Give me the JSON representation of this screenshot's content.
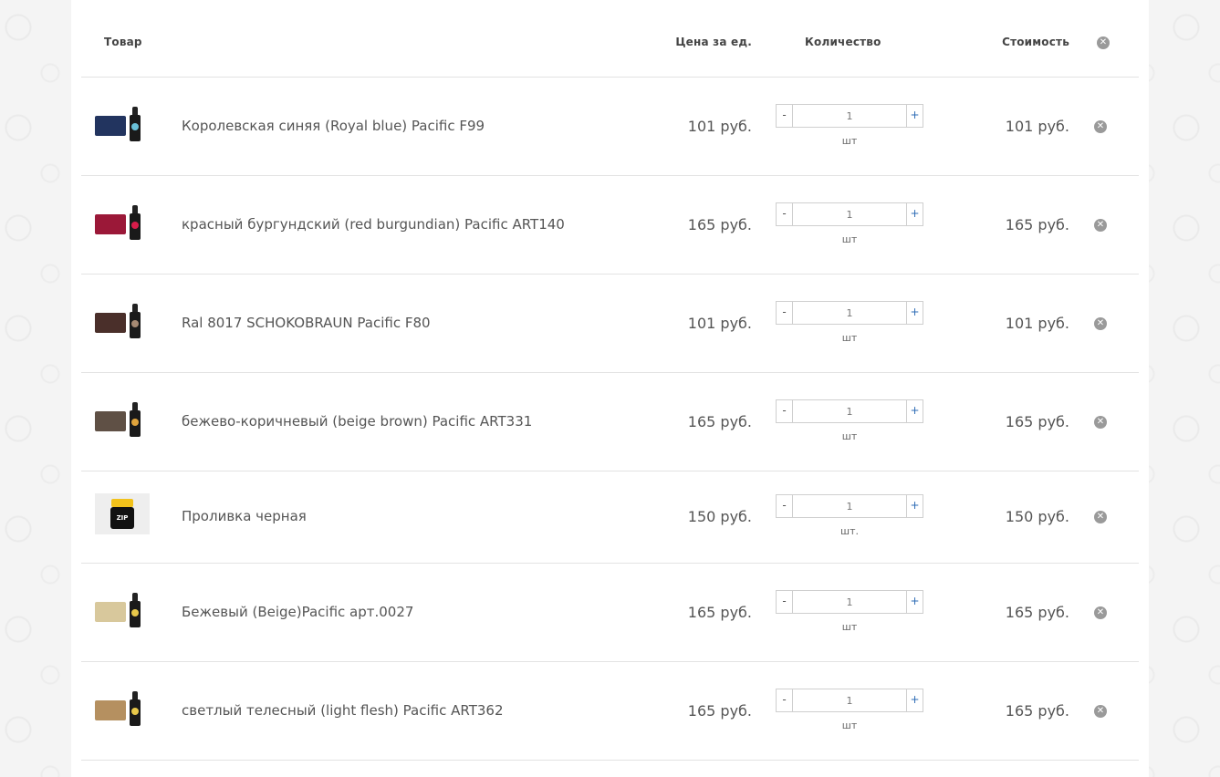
{
  "header": {
    "product": "Товар",
    "price": "Цена за ед.",
    "quantity": "Количество",
    "total": "Стоимость",
    "remove_all_icon": "close-circle-icon"
  },
  "items": [
    {
      "name": "Королевская синяя (Royal blue) Pacific F99",
      "price": "101 руб.",
      "qty": "1",
      "unit": "шт",
      "total": "101 руб.",
      "swatch_color": "#22345f",
      "label_color": "#6ac1d8",
      "thumb": "bottle"
    },
    {
      "name": "красный бургундский (red burgundian) Pacific ART140",
      "price": "165 руб.",
      "qty": "1",
      "unit": "шт",
      "total": "165 руб.",
      "swatch_color": "#9b1838",
      "label_color": "#d81c4a",
      "thumb": "bottle"
    },
    {
      "name": "Ral 8017 SCHOKOBRAUN Pacific F80",
      "price": "101 руб.",
      "qty": "1",
      "unit": "шт",
      "total": "101 руб.",
      "swatch_color": "#4a2f2a",
      "label_color": "#a68a73",
      "thumb": "bottle"
    },
    {
      "name": "бежево-коричневый (beige brown) Pacific ART331",
      "price": "165 руб.",
      "qty": "1",
      "unit": "шт",
      "total": "165 руб.",
      "swatch_color": "#5f5045",
      "label_color": "#e0a43c",
      "thumb": "bottle"
    },
    {
      "name": "Проливка черная",
      "price": "150 руб.",
      "qty": "1",
      "unit": "шт.",
      "total": "150 руб.",
      "swatch_color": "#f2c21b",
      "label_color": "#111111",
      "thumb": "jar",
      "jar_text": "ZIP"
    },
    {
      "name": "Бежевый (Beige)Pacific арт.0027",
      "price": "165 руб.",
      "qty": "1",
      "unit": "шт",
      "total": "165 руб.",
      "swatch_color": "#d8c89c",
      "label_color": "#e8c84a",
      "thumb": "bottle"
    },
    {
      "name": "светлый телесный (light flesh) Pacific ART362",
      "price": "165 руб.",
      "qty": "1",
      "unit": "шт",
      "total": "165 руб.",
      "swatch_color": "#b59060",
      "label_color": "#e8c84a",
      "thumb": "bottle"
    }
  ],
  "controls": {
    "minus": "-",
    "plus": "+",
    "remove": "✕"
  }
}
